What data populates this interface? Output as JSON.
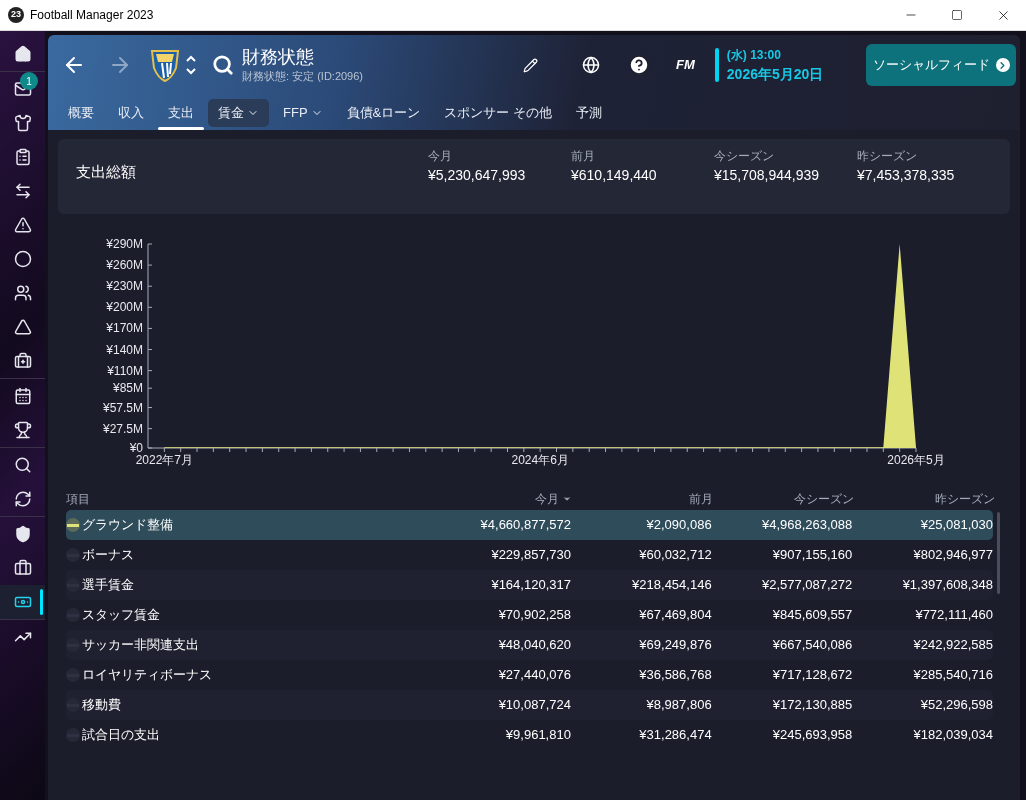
{
  "window": {
    "title": "Football Manager 2023",
    "app_badge": "23"
  },
  "sidebar": {
    "items": [
      {
        "selected": false
      },
      {
        "selected": false,
        "badge": "1"
      },
      {
        "selected": false
      },
      {
        "selected": false
      },
      {
        "selected": false
      },
      {
        "selected": false
      },
      {
        "selected": false
      },
      {
        "selected": false
      },
      {
        "selected": false
      },
      {
        "selected": false
      },
      {
        "selected": false
      },
      {
        "selected": false
      },
      {
        "selected": false
      },
      {
        "selected": false
      },
      {
        "selected": false
      },
      {
        "selected": false
      },
      {
        "selected": true
      },
      {
        "selected": false
      }
    ]
  },
  "header": {
    "title": "財務状態",
    "subtitle": "財務状態: 安定 (ID:2096)",
    "logo_text": "FM",
    "time": "(水) 13:00",
    "date": "2026年5月20日",
    "social_button": "ソーシャルフィード"
  },
  "tabs": [
    {
      "label": "概要",
      "selected": false,
      "dropdown": false,
      "highlighted": false
    },
    {
      "label": "収入",
      "selected": false,
      "dropdown": false,
      "highlighted": false
    },
    {
      "label": "支出",
      "selected": true,
      "dropdown": false,
      "highlighted": false
    },
    {
      "label": "賃金",
      "selected": false,
      "dropdown": true,
      "highlighted": true
    },
    {
      "label": "FFP",
      "selected": false,
      "dropdown": true,
      "highlighted": false
    },
    {
      "label": "負債&ローン",
      "selected": false,
      "dropdown": false,
      "highlighted": false
    },
    {
      "label": "スポンサー その他",
      "selected": false,
      "dropdown": false,
      "highlighted": false
    },
    {
      "label": "予測",
      "selected": false,
      "dropdown": false,
      "highlighted": false
    }
  ],
  "summary": {
    "title": "支出総額",
    "stats": [
      {
        "label": "今月",
        "value": "¥5,230,647,993"
      },
      {
        "label": "前月",
        "value": "¥610,149,440"
      },
      {
        "label": "今シーズン",
        "value": "¥15,708,944,939"
      },
      {
        "label": "昨シーズン",
        "value": "¥7,453,378,335"
      }
    ]
  },
  "chart_data": {
    "type": "area",
    "categories": [
      "2022年7月",
      null,
      null,
      null,
      null,
      null,
      null,
      null,
      null,
      null,
      null,
      null,
      null,
      null,
      null,
      null,
      null,
      null,
      null,
      null,
      null,
      null,
      null,
      "2024年6月",
      null,
      null,
      null,
      null,
      null,
      null,
      null,
      null,
      null,
      null,
      null,
      null,
      null,
      null,
      null,
      null,
      null,
      null,
      null,
      null,
      null,
      null,
      "2026年5月"
    ],
    "series": [
      {
        "color": "#dfe377",
        "values": [
          1,
          1,
          1,
          1,
          1,
          1,
          1,
          1,
          1,
          1,
          1,
          1,
          1,
          1,
          1,
          1,
          1,
          1,
          1,
          1,
          1,
          1,
          1,
          1,
          1,
          1,
          1,
          1,
          1,
          1,
          1,
          1,
          1,
          1,
          1,
          1,
          1,
          1,
          1,
          1,
          1,
          1,
          1,
          1,
          1,
          290,
          1
        ]
      }
    ],
    "ylim": [
      0,
      290
    ],
    "yticks": [
      {
        "value": 0,
        "label": "¥0"
      },
      {
        "value": 27.5,
        "label": "¥27.5M"
      },
      {
        "value": 57.5,
        "label": "¥57.5M"
      },
      {
        "value": 85,
        "label": "¥85M"
      },
      {
        "value": 110,
        "label": "¥110M"
      },
      {
        "value": 140,
        "label": "¥140M"
      },
      {
        "value": 170,
        "label": "¥170M"
      },
      {
        "value": 200,
        "label": "¥200M"
      },
      {
        "value": 230,
        "label": "¥230M"
      },
      {
        "value": 260,
        "label": "¥260M"
      },
      {
        "value": 290,
        "label": "¥290M"
      }
    ]
  },
  "table": {
    "columns": [
      {
        "label": "項目",
        "sorted": false
      },
      {
        "label": "今月",
        "sorted": true
      },
      {
        "label": "前月",
        "sorted": false
      },
      {
        "label": "今シーズン",
        "sorted": false
      },
      {
        "label": "昨シーズン",
        "sorted": false
      }
    ],
    "rows": [
      {
        "selected": true,
        "cells": [
          "グラウンド整備",
          "¥4,660,877,572",
          "¥2,090,086",
          "¥4,968,263,088",
          "¥25,081,030"
        ]
      },
      {
        "selected": false,
        "cells": [
          "ボーナス",
          "¥229,857,730",
          "¥60,032,712",
          "¥907,155,160",
          "¥802,946,977"
        ]
      },
      {
        "selected": false,
        "cells": [
          "選手賃金",
          "¥164,120,317",
          "¥218,454,146",
          "¥2,577,087,272",
          "¥1,397,608,348"
        ]
      },
      {
        "selected": false,
        "cells": [
          "スタッフ賃金",
          "¥70,902,258",
          "¥67,469,804",
          "¥845,609,557",
          "¥772,111,460"
        ]
      },
      {
        "selected": false,
        "cells": [
          "サッカー非関連支出",
          "¥48,040,620",
          "¥69,249,876",
          "¥667,540,086",
          "¥242,922,585"
        ]
      },
      {
        "selected": false,
        "cells": [
          "ロイヤリティボーナス",
          "¥27,440,076",
          "¥36,586,768",
          "¥717,128,672",
          "¥285,540,716"
        ]
      },
      {
        "selected": false,
        "cells": [
          "移動費",
          "¥10,087,724",
          "¥8,987,806",
          "¥172,130,885",
          "¥52,296,598"
        ]
      },
      {
        "selected": false,
        "cells": [
          "試合日の支出",
          "¥9,961,810",
          "¥31,286,474",
          "¥245,693,958",
          "¥182,039,034"
        ]
      }
    ]
  }
}
